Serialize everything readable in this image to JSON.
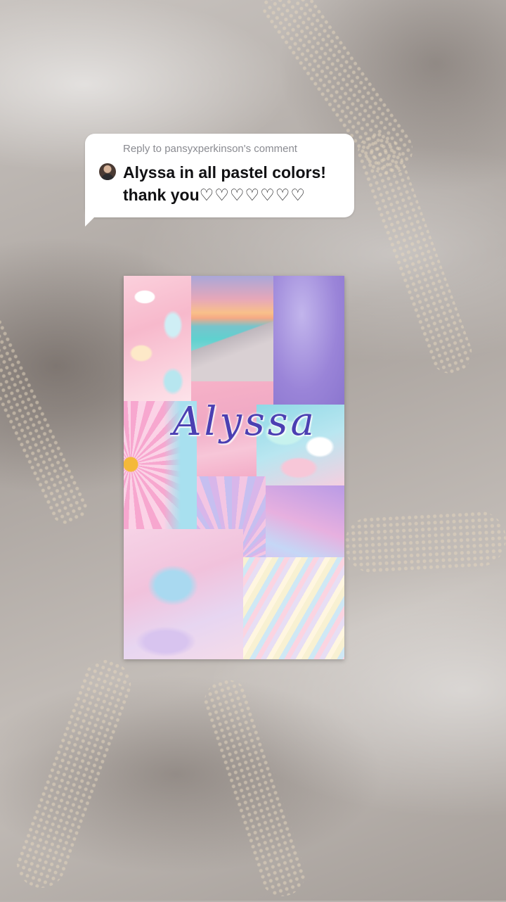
{
  "reply_bubble": {
    "label": "Reply to pansyxperkinson's comment",
    "line1": "Alyssa in all pastel colors!",
    "line2_text": "thank you",
    "line2_hearts": "♡♡♡♡♡♡♡"
  },
  "collage": {
    "title": "Alyssa"
  },
  "icons": {
    "avatar": "commenter-avatar"
  },
  "colors": {
    "title": "#4b3fb2",
    "bubble": "#ffffff",
    "label": "#8a8b91"
  }
}
